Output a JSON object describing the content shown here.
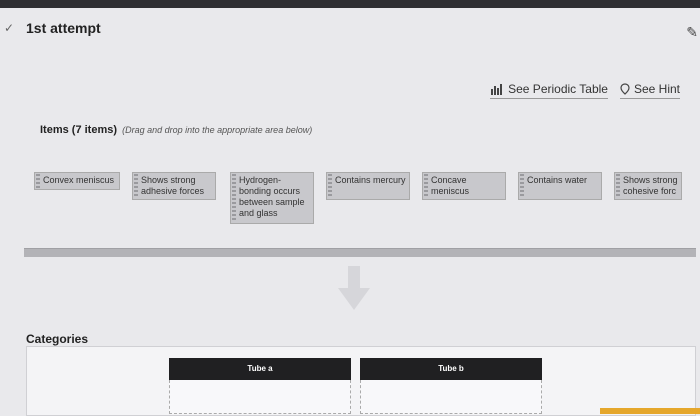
{
  "header": {
    "attempt_label": "1st attempt"
  },
  "toolbar": {
    "periodic_table_label": "See Periodic Table",
    "hint_label": "See Hint"
  },
  "items_section": {
    "heading": "Items (7 items)",
    "instruction": "(Drag and drop into the appropriate area below)",
    "items": [
      {
        "label": "Convex meniscus"
      },
      {
        "label": "Shows strong adhesive forces"
      },
      {
        "label": "Hydrogen-bonding occurs between sample and glass"
      },
      {
        "label": "Contains mercury"
      },
      {
        "label": "Concave meniscus"
      },
      {
        "label": "Contains water"
      },
      {
        "label": "Shows strong cohesive forc"
      }
    ]
  },
  "categories": {
    "label": "Categories",
    "tubes": [
      {
        "label": "Tube a"
      },
      {
        "label": "Tube b"
      }
    ]
  },
  "icons": {
    "collapse": "chevron-down-icon",
    "edit": "pencil-icon",
    "periodic_table": "bar-chart-icon",
    "hint": "location-pin-icon",
    "drag": "drag-handle-icon",
    "drop_direction": "arrow-down-icon"
  },
  "colors": {
    "background": "#e9e9ec",
    "item_fill": "#c8c8cc",
    "tube_header": "#202022",
    "accent": "#e5a72c"
  }
}
